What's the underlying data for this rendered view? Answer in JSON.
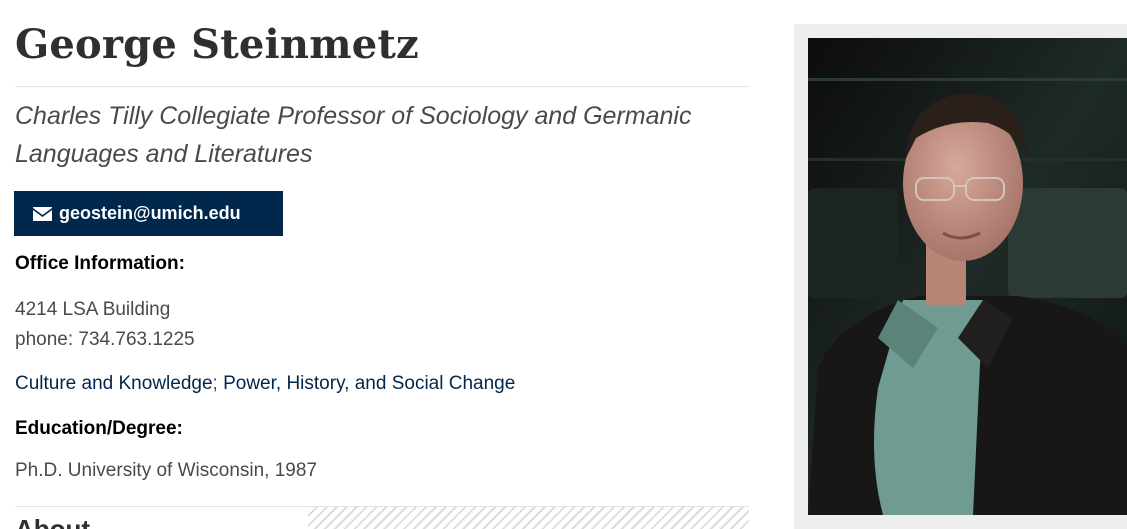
{
  "profile": {
    "name": "George Steinmetz",
    "title": "Charles Tilly Collegiate Professor of Sociology and Germanic Languages and Literatures",
    "email": "geostein@umich.edu",
    "office_heading": "Office Information:",
    "office_lines": [
      "4214 LSA Building",
      "phone: 734.763.1225"
    ],
    "areas": [
      "Culture and Knowledge",
      "Power, History, and Social Change"
    ],
    "areas_separator": ";",
    "education_heading": "Education/Degree:",
    "education": "Ph.D. University of Wisconsin, 1987",
    "about_heading": "About"
  },
  "icons": {
    "email": "envelope-icon"
  },
  "colors": {
    "accent": "#00274c",
    "text": "#4a4a4a",
    "panel": "#eeeeee"
  }
}
